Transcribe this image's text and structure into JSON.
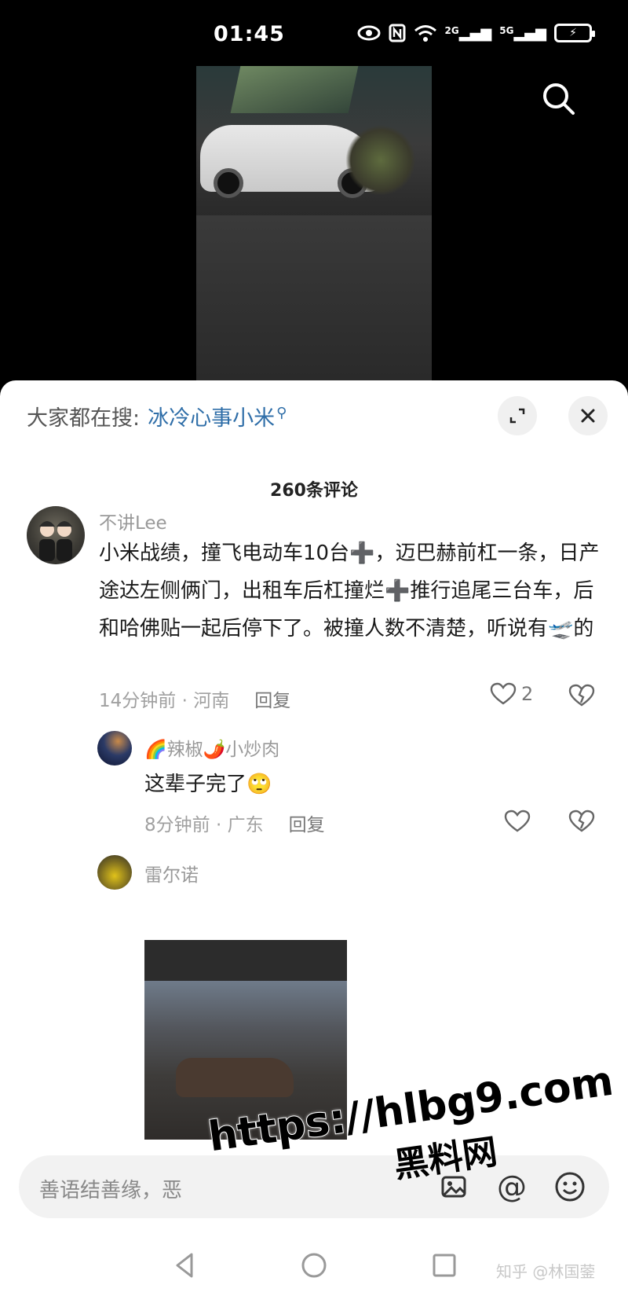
{
  "status_bar": {
    "time": "01:45",
    "icons": [
      "eye-icon",
      "nfc-icon",
      "wifi-icon",
      "signal-2g-icon",
      "signal-5g-icon",
      "battery-charging-icon"
    ],
    "signal_1_label": "2G",
    "signal_2_label": "5G"
  },
  "video": {
    "description_icon": "search-icon"
  },
  "comments_panel": {
    "hot_search_label": "大家都在搜:",
    "hot_search_keyword": "冰冷心事小米",
    "comment_count": "260条评论"
  },
  "comments": [
    {
      "username": "不讲Lee",
      "text": "小米战绩，撞飞电动车10台➕，迈巴赫前杠一条，日产途达左侧俩门，出租车后杠撞烂➕推行追尾三台车，后和哈佛贴一起后停下了。被撞人数不清楚，听说有🛫的",
      "time": "14分钟前",
      "location": "河南",
      "reply_label": "回复",
      "likes": "2"
    },
    {
      "username": "🌈辣椒🌶️小炒肉",
      "text": "这辈子完了🙄",
      "time": "8分钟前",
      "location": "广东",
      "reply_label": "回复"
    },
    {
      "username": "雷尔诺"
    }
  ],
  "input_bar": {
    "placeholder": "善语结善缘，恶",
    "icons": [
      "image-icon",
      "at-icon",
      "emoji-icon"
    ]
  },
  "watermark": {
    "url": "https://hlbg9.com",
    "name": "黑料网"
  },
  "credit": "知乎 @林国蓥",
  "colors": {
    "keyword": "#2f6ea8",
    "muted": "#a0a0a0"
  }
}
